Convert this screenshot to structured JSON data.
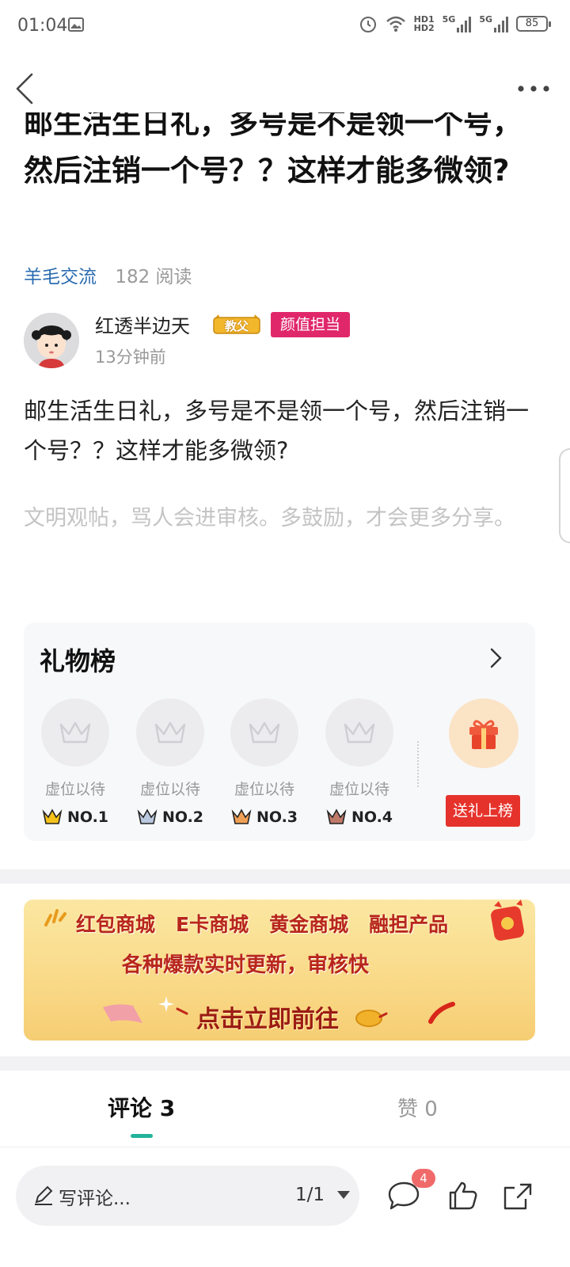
{
  "status_bar": {
    "time": "01:04",
    "network": "5G",
    "hd1": "HD1",
    "hd2": "HD2",
    "battery": "85"
  },
  "post": {
    "title": "邮生活生日礼，多号是不是领一个号，然后注销一个号？？这样才能多微领?",
    "category": "羊毛交流",
    "reads": "182 阅读",
    "author": {
      "name": "红透半边天",
      "badge_gold": "教父",
      "badge_tag": "颜值担当",
      "time_ago": "13分钟前"
    },
    "content": "邮生活生日礼，多号是不是领一个号，然后注销一个号？？这样才能多微领?",
    "hint": "文明观帖，骂人会进审核。多鼓励，才会更多分享。"
  },
  "gift_board": {
    "title": "礼物榜",
    "slots": [
      {
        "label": "虚位以待",
        "rank": "NO.1"
      },
      {
        "label": "虚位以待",
        "rank": "NO.2"
      },
      {
        "label": "虚位以待",
        "rank": "NO.3"
      },
      {
        "label": "虚位以待",
        "rank": "NO.4"
      }
    ],
    "send_button": "送礼上榜"
  },
  "banner": {
    "items": [
      "红包商城",
      "E卡商城",
      "黄金商城",
      "融担产品"
    ],
    "subtitle": "各种爆款实时更新，审核快",
    "cta": "点击立即前往"
  },
  "tabs": {
    "comments_label": "评论 3",
    "likes_label": "赞 0"
  },
  "bottom_bar": {
    "comment_placeholder": "写评论...",
    "page_indicator": "1/1",
    "comment_count": "4"
  },
  "colors": {
    "accent_teal": "#22b39a",
    "category_blue": "#2b6cb0",
    "badge_pink": "#e0276a",
    "send_red": "#e5332c"
  },
  "icons": [
    "back-icon",
    "more-icon",
    "gallery-icon",
    "alarm-icon",
    "wifi-icon",
    "crown-icon",
    "gift-icon",
    "chevron-right-icon",
    "pen-icon",
    "comment-icon",
    "thumbs-up-icon",
    "share-icon"
  ]
}
